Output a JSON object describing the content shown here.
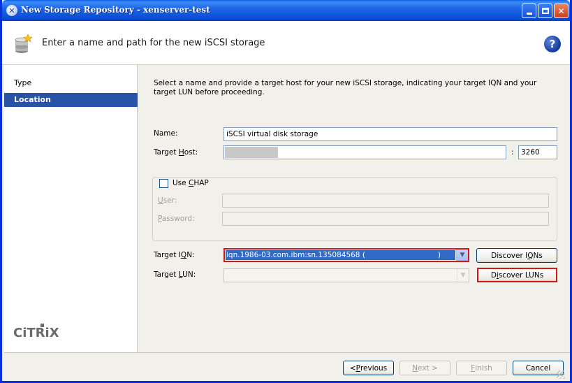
{
  "window": {
    "title": "New Storage Repository - xenserver-test"
  },
  "header": {
    "title": "Enter a name and path for the new iSCSI storage",
    "help": "?"
  },
  "sidebar": {
    "items": [
      {
        "label": "Type"
      },
      {
        "label": "Location"
      }
    ],
    "logo": "CiTRiX"
  },
  "form": {
    "description": "Select a name and provide a target host for your new iSCSI storage, indicating your target IQN and your target LUN before proceeding.",
    "name_label": "Name:",
    "name_value": "iSCSI virtual disk storage",
    "target_host_label_pre": "Target ",
    "target_host_label_u": "H",
    "target_host_label_post": "ost:",
    "port_separator": ":",
    "port_value": "3260",
    "chap_label_pre": "Use ",
    "chap_label_u": "C",
    "chap_label_post": "HAP",
    "user_label_u": "U",
    "user_label_post": "ser:",
    "password_label_u": "P",
    "password_label_post": "assword:",
    "iqn_label_pre": "Target I",
    "iqn_label_u": "Q",
    "iqn_label_post": "N:",
    "iqn_value_pre": "iqn.1986-03.com.ibm:sn.135084568 (",
    "iqn_value_post": ")",
    "lun_label_pre": "Target ",
    "lun_label_u": "L",
    "lun_label_post": "UN:",
    "discover_iqns_pre": "Discover I",
    "discover_iqns_u": "Q",
    "discover_iqns_post": "Ns",
    "discover_luns_pre": "D",
    "discover_luns_u": "i",
    "discover_luns_post": "scover LUNs"
  },
  "footer": {
    "previous_pre": "< ",
    "previous_u": "P",
    "previous_post": "revious",
    "next_pre": "",
    "next_u": "N",
    "next_post": "ext >",
    "finish_pre": "",
    "finish_u": "F",
    "finish_post": "inish",
    "cancel": "Cancel"
  },
  "colors": {
    "title_bar": "#0a4fd6",
    "selection": "#2953a6",
    "highlight_border": "#d01818"
  }
}
